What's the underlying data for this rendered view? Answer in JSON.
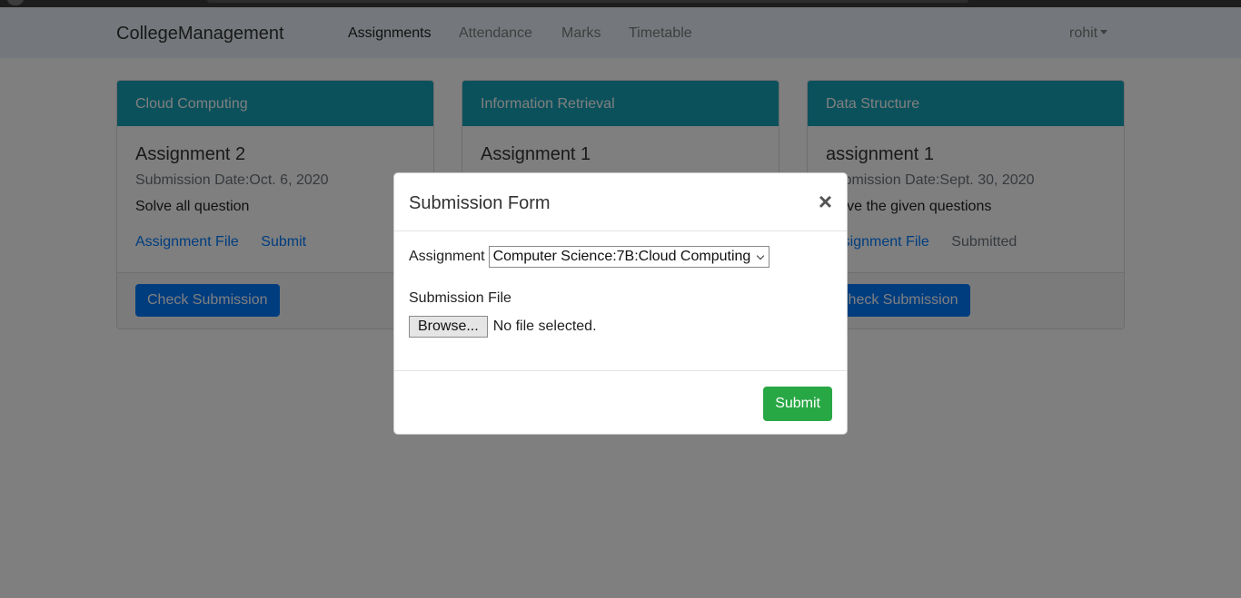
{
  "nav": {
    "brand": "CollegeManagement",
    "links": [
      "Assignments",
      "Attendance",
      "Marks",
      "Timetable"
    ],
    "user": "rohit"
  },
  "cards": [
    {
      "header": "Cloud Computing",
      "title": "Assignment 2",
      "date": "Submission Date:Oct. 6, 2020",
      "text": "Solve all question",
      "link1": "Assignment File",
      "link2": "Submit",
      "button": "Check Submission"
    },
    {
      "header": "Information Retrieval",
      "title": "Assignment 1"
    },
    {
      "header": "Data Structure",
      "title": "assignment 1",
      "date": "Submission Date:Sept. 30, 2020",
      "text": "Solve the given questions",
      "link1": "Assignment File",
      "status": "Submitted",
      "button": "Check Submission"
    }
  ],
  "modal": {
    "title": "Submission Form",
    "close": "×",
    "assignment_label": "Assignment",
    "assignment_value": "Computer Science:7B:Cloud Computing",
    "file_label": "Submission File",
    "browse": "Browse...",
    "no_file": "No file selected.",
    "submit": "Submit"
  },
  "colors": {
    "header": "#17a2b8",
    "primary": "#007bff",
    "success": "#28a745"
  }
}
